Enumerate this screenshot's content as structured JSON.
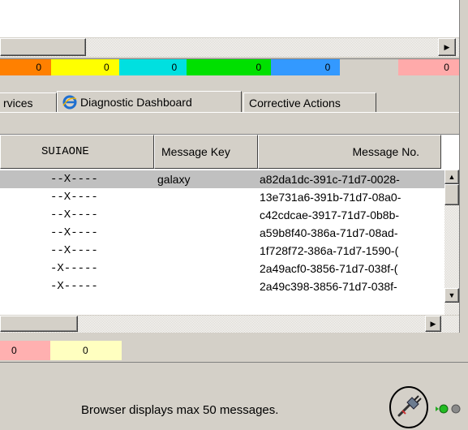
{
  "top_scroll": {
    "right_arrow": "▶"
  },
  "counters": [
    {
      "value": "0",
      "color": "#ff8000"
    },
    {
      "value": "0",
      "color": "#ffff00"
    },
    {
      "value": "0",
      "color": "#00e0e0"
    },
    {
      "value": "0",
      "color": "#00e000"
    },
    {
      "value": "0",
      "color": "#3399ff"
    },
    {
      "value": "",
      "color": "#d4d0c8"
    },
    {
      "value": "0",
      "color": "#ffaaaa"
    }
  ],
  "tabs": {
    "services": "rvices",
    "diagnostic": "Diagnostic Dashboard",
    "corrective": "Corrective Actions"
  },
  "table": {
    "columns": [
      "SUIAONE",
      "Message Key",
      "Message No."
    ],
    "rows": [
      {
        "suiaone": "--X----",
        "key": "galaxy",
        "no": "a82da1dc-391c-71d7-0028-",
        "selected": true
      },
      {
        "suiaone": "--X----",
        "key": "",
        "no": "13e731a6-391b-71d7-08a0-"
      },
      {
        "suiaone": "--X----",
        "key": "",
        "no": "c42cdcae-3917-71d7-0b8b-"
      },
      {
        "suiaone": "--X----",
        "key": "",
        "no": "a59b8f40-386a-71d7-08ad-"
      },
      {
        "suiaone": "--X----",
        "key": "",
        "no": "1f728f72-386a-71d7-1590-("
      },
      {
        "suiaone": "-X-----",
        "key": "",
        "no": "2a49acf0-3856-71d7-038f-("
      },
      {
        "suiaone": "-X-----",
        "key": "",
        "no": "2a49c398-3856-71d7-038f-"
      }
    ]
  },
  "bottom_counters": [
    {
      "value": "0",
      "color": "#ffb0b0"
    },
    {
      "value": "0",
      "color": "#ffffc0"
    }
  ],
  "status": {
    "message": "Browser displays max 50 messages."
  }
}
